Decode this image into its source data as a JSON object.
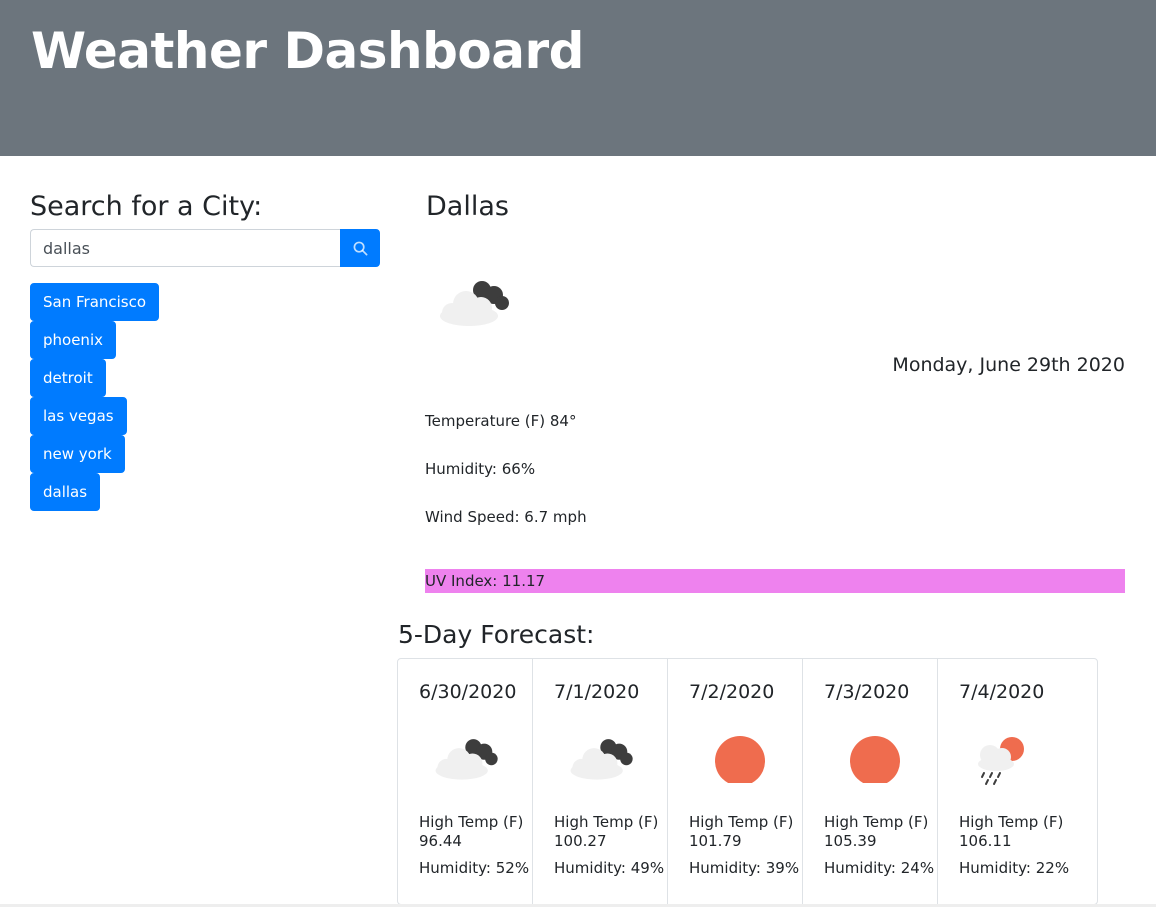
{
  "header": {
    "title": "Weather Dashboard"
  },
  "search": {
    "heading": "Search for a City:",
    "value": "dallas",
    "button_icon": "search-icon"
  },
  "history": [
    {
      "label": "San Francisco"
    },
    {
      "label": "phoenix"
    },
    {
      "label": "detroit"
    },
    {
      "label": "las vegas"
    },
    {
      "label": "new york"
    },
    {
      "label": "dallas"
    }
  ],
  "current": {
    "city": "Dallas",
    "icon": "cloudy-night-icon",
    "date": "Monday, June 29th 2020",
    "temperature": "Temperature (F) 84°",
    "humidity": "Humidity: 66%",
    "wind": "Wind Speed: 6.7 mph",
    "uv": "UV Index: 11.17",
    "uv_color": "#ee82ee"
  },
  "forecast": {
    "heading": "5-Day Forecast:",
    "days": [
      {
        "date": "6/30/2020",
        "icon": "cloudy-night-icon",
        "temp_label": "High Temp (F)",
        "temp": "96.44",
        "humidity": "Humidity: 52%"
      },
      {
        "date": "7/1/2020",
        "icon": "cloudy-night-icon",
        "temp_label": "High Temp (F)",
        "temp": "100.27",
        "humidity": "Humidity: 49%"
      },
      {
        "date": "7/2/2020",
        "icon": "sun-icon",
        "temp_label": "High Temp (F)",
        "temp": "101.79",
        "humidity": "Humidity: 39%"
      },
      {
        "date": "7/3/2020",
        "icon": "sun-icon",
        "temp_label": "High Temp (F)",
        "temp": "105.39",
        "humidity": "Humidity: 24%"
      },
      {
        "date": "7/4/2020",
        "icon": "rain-sun-icon",
        "temp_label": "High Temp (F)",
        "temp": "106.11",
        "humidity": "Humidity: 22%"
      }
    ]
  },
  "colors": {
    "header_bg": "#6c757d",
    "button_blue": "#007bff",
    "sun_orange": "#ef6c4e"
  }
}
